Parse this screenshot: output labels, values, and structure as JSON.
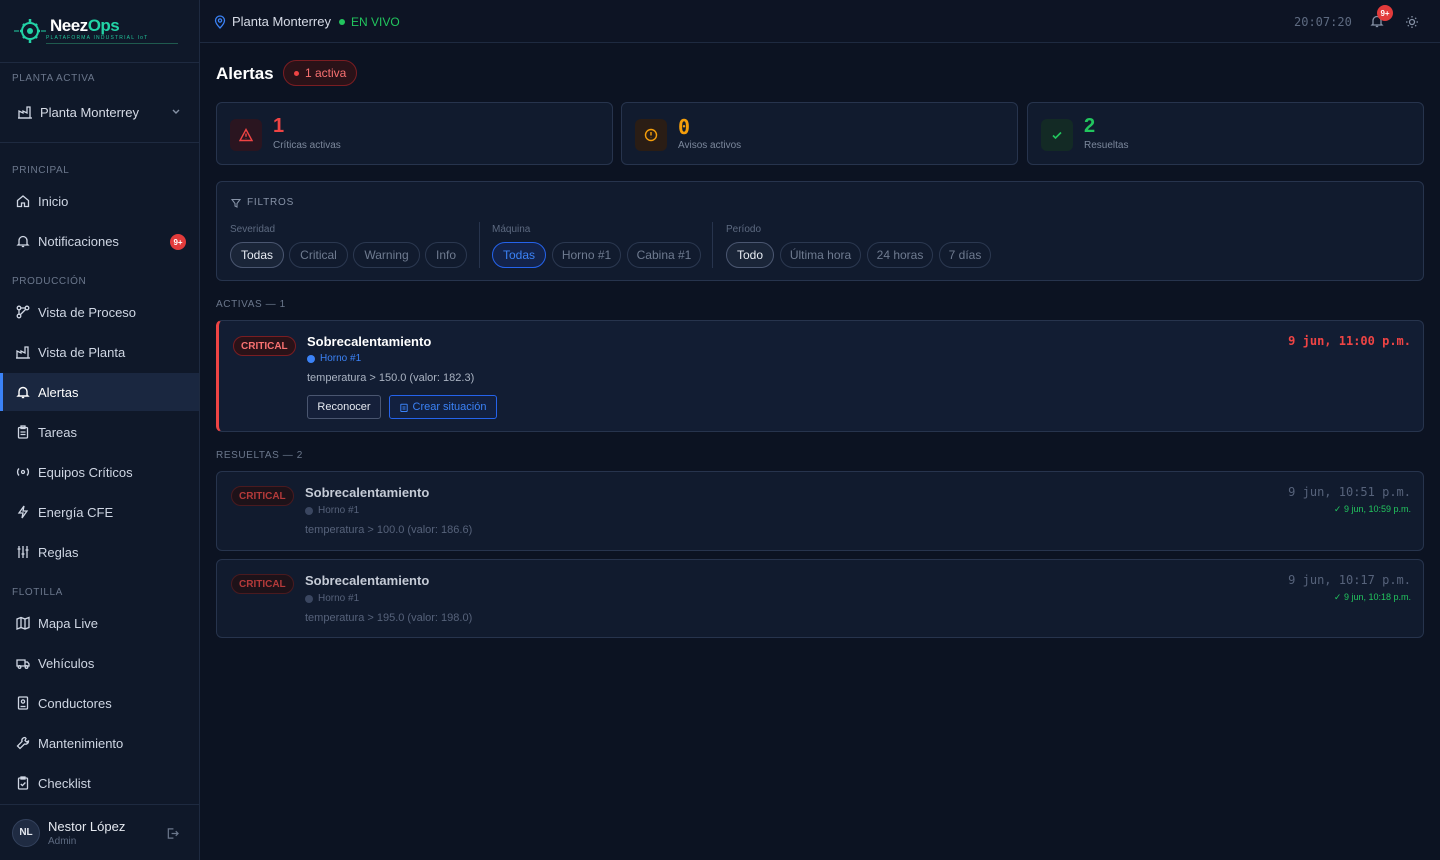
{
  "brand": {
    "name_a": "Neez",
    "name_b": "Ops",
    "tagline": "PLATAFORMA INDUSTRIAL IoT"
  },
  "sidebar": {
    "plant_section": "PLANTA ACTIVA",
    "plant": "Planta Monterrey",
    "sections": {
      "principal": "PRINCIPAL",
      "produccion": "PRODUCCIÓN",
      "flotilla": "FLOTILLA"
    },
    "items": [
      {
        "label": "Inicio",
        "icon": "home-icon"
      },
      {
        "label": "Notificaciones",
        "icon": "bell-icon",
        "badge": "9+"
      },
      {
        "label": "Vista de Proceso",
        "icon": "process-icon"
      },
      {
        "label": "Vista de Planta",
        "icon": "factory-icon"
      },
      {
        "label": "Alertas",
        "icon": "bell-icon",
        "active": true
      },
      {
        "label": "Tareas",
        "icon": "clipboard-icon"
      },
      {
        "label": "Equipos Críticos",
        "icon": "signal-icon"
      },
      {
        "label": "Energía CFE",
        "icon": "bolt-icon"
      },
      {
        "label": "Reglas",
        "icon": "sliders-icon"
      },
      {
        "label": "Mapa Live",
        "icon": "map-icon"
      },
      {
        "label": "Vehículos",
        "icon": "truck-icon"
      },
      {
        "label": "Conductores",
        "icon": "id-card-icon"
      },
      {
        "label": "Mantenimiento",
        "icon": "wrench-icon"
      },
      {
        "label": "Checklist",
        "icon": "checklist-icon"
      }
    ],
    "user": {
      "initials": "NL",
      "name": "Nestor López",
      "role": "Admin"
    }
  },
  "topbar": {
    "location": "Planta Monterrey",
    "live": "EN VIVO",
    "clock": "20:07:20",
    "bell_badge": "9+"
  },
  "page": {
    "title": "Alertas",
    "active_pill": "1 activa"
  },
  "stats": [
    {
      "value": "1",
      "label": "Críticas activas",
      "color": "#ef4444"
    },
    {
      "value": "0",
      "label": "Avisos activos",
      "color": "#f59e0b"
    },
    {
      "value": "2",
      "label": "Resueltas",
      "color": "#22c55e"
    }
  ],
  "filters": {
    "title": "FILTROS",
    "severity": {
      "label": "Severidad",
      "options": [
        "Todas",
        "Critical",
        "Warning",
        "Info"
      ],
      "selected": "Todas"
    },
    "machine": {
      "label": "Máquina",
      "options": [
        "Todas",
        "Horno #1",
        "Cabina #1"
      ],
      "selected": "Todas"
    },
    "period": {
      "label": "Período",
      "options": [
        "Todo",
        "Última hora",
        "24 horas",
        "7 días"
      ],
      "selected": "Todo"
    }
  },
  "active_section": "ACTIVAS — 1",
  "resolved_section": "RESUELTAS — 2",
  "active_alerts": [
    {
      "severity": "CRITICAL",
      "title": "Sobrecalentamiento",
      "machine": "Horno #1",
      "detail": "temperatura > 150.0 (valor: 182.3)",
      "time": "9 jun, 11:00 p.m.",
      "ack_label": "Reconocer",
      "create_label": "Crear situación"
    }
  ],
  "resolved_alerts": [
    {
      "severity": "CRITICAL",
      "title": "Sobrecalentamiento",
      "machine": "Horno #1",
      "detail": "temperatura > 100.0 (valor: 186.6)",
      "time": "9 jun, 10:51 p.m.",
      "resolved": "✓ 9 jun, 10:59 p.m."
    },
    {
      "severity": "CRITICAL",
      "title": "Sobrecalentamiento",
      "machine": "Horno #1",
      "detail": "temperatura > 195.0 (valor: 198.0)",
      "time": "9 jun, 10:17 p.m.",
      "resolved": "✓ 9 jun, 10:18 p.m."
    }
  ]
}
